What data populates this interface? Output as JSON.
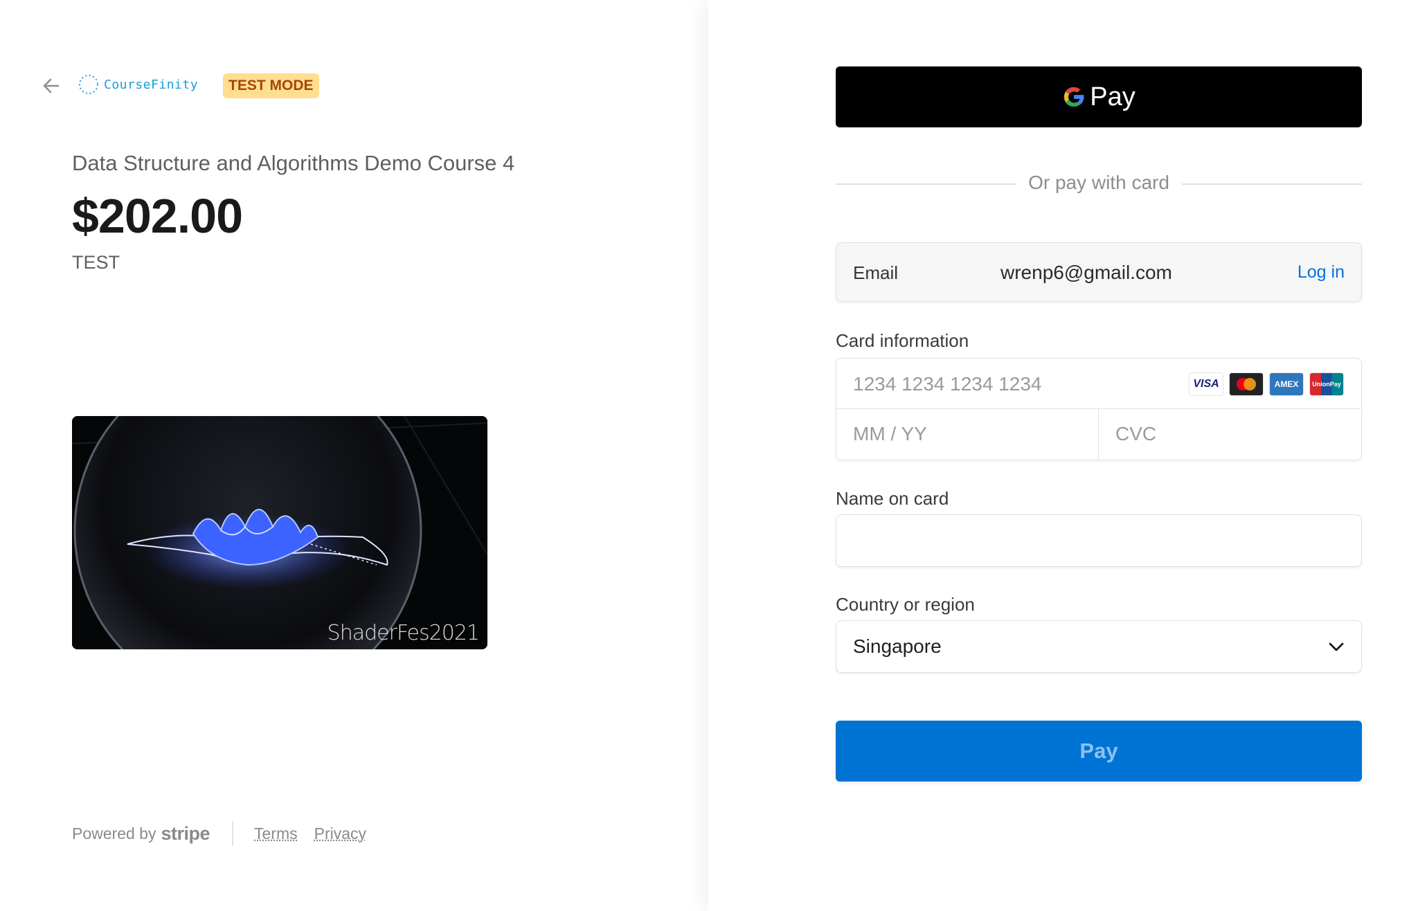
{
  "merchant": {
    "name": "CourseFinity",
    "test_badge": "TEST MODE"
  },
  "product": {
    "title": "Data Structure and Algorithms Demo Course 4",
    "price": "$202.00",
    "description": "TEST",
    "image_watermark": "ShaderFes2021"
  },
  "footer": {
    "powered_by": "Powered by",
    "stripe": "stripe",
    "terms": "Terms",
    "privacy": "Privacy"
  },
  "payment": {
    "gpay_label": "Pay",
    "divider_text": "Or pay with card",
    "email_label": "Email",
    "email_value": "wrenp6@gmail.com",
    "login_link": "Log in",
    "card_label": "Card information",
    "card_number_placeholder": "1234 1234 1234 1234",
    "expiry_placeholder": "MM / YY",
    "cvc_placeholder": "CVC",
    "card_brands": [
      "visa",
      "mastercard",
      "amex",
      "unionpay"
    ],
    "name_label": "Name on card",
    "name_value": "",
    "country_label": "Country or region",
    "country_value": "Singapore",
    "pay_button": "Pay"
  },
  "colors": {
    "accent_blue": "#0074d4",
    "link_blue": "#0570de",
    "badge_bg": "#ffde92",
    "badge_text": "#a2470a"
  }
}
